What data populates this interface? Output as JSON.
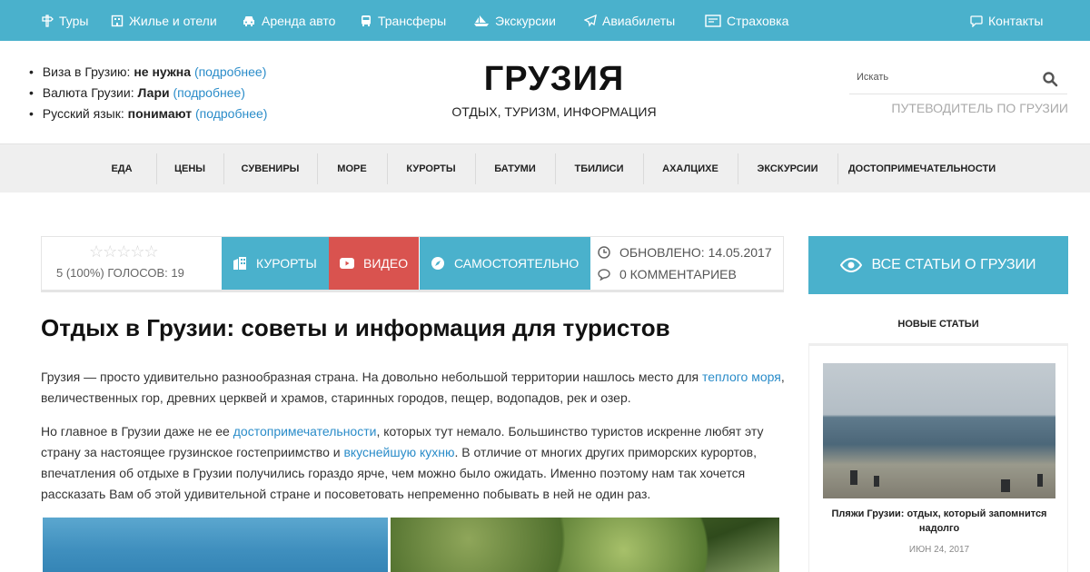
{
  "topbar": {
    "bg": "#4ab1cc",
    "items": [
      {
        "label": "Туры",
        "icon": "signpost-icon"
      },
      {
        "label": "Жилье и отели",
        "icon": "hotel-icon"
      },
      {
        "label": "Аренда авто",
        "icon": "car-icon"
      },
      {
        "label": "Трансферы",
        "icon": "bus-icon"
      },
      {
        "label": "Экскурсии",
        "icon": "ship-icon"
      },
      {
        "label": "Авиабилеты",
        "icon": "plane-icon"
      },
      {
        "label": "Страховка",
        "icon": "document-icon"
      },
      {
        "label": "Контакты",
        "icon": "chat-icon"
      }
    ]
  },
  "header": {
    "info": [
      {
        "label": "Виза в Грузию:",
        "value": "не нужна",
        "link": "(подробнее)"
      },
      {
        "label": "Валюта Грузии:",
        "value": "Лари",
        "link": "(подробнее)"
      },
      {
        "label": "Русский язык:",
        "value": "понимают",
        "link": "(подробнее)"
      }
    ],
    "title": "ГРУЗИЯ",
    "subtitle": "ОТДЫХ, ТУРИЗМ, ИНФОРМАЦИЯ",
    "search_placeholder": "Искать",
    "guide": "ПУТЕВОДИТЕЛЬ ПО ГРУЗИИ"
  },
  "nav": [
    "ЕДА",
    "ЦЕНЫ",
    "СУВЕНИРЫ",
    "МОРЕ",
    "КУРОРТЫ",
    "БАТУМИ",
    "ТБИЛИСИ",
    "АХАЛЦИХЕ",
    "ЭКСКУРСИИ",
    "ДОСТОПРИМЕЧАТЕЛЬНОСТИ"
  ],
  "meta": {
    "stars": "☆☆☆☆☆",
    "votes": "5 (100%) ГОЛОСОВ:  19",
    "buttons": [
      {
        "label": "КУРОРТЫ",
        "color": "#4ab1cc",
        "icon": "building-icon"
      },
      {
        "label": "ВИДЕО",
        "color": "#d9534f",
        "icon": "youtube-icon"
      },
      {
        "label": "САМОСТОЯТЕЛЬНО",
        "color": "#4ab1cc",
        "icon": "compass-icon"
      }
    ],
    "updated": "ОБНОВЛЕНО: 14.05.2017",
    "comments": "0 КОММЕНТАРИЕВ"
  },
  "article": {
    "title": "Отдых в Грузии: советы и информация для туристов",
    "p1": {
      "text1": "Грузия — просто удивительно разнообразная страна. На довольно небольшой территории нашлось место для ",
      "link1": "теплого моря",
      "text2": ", величественных гор, древних церквей и храмов, старинных городов, пещер, водопадов, рек и озер."
    },
    "p2": {
      "text1": "Но главное в Грузии даже не ее ",
      "link1": "достопримечательности",
      "text2": ", которых тут немало. Большинство туристов искренне любят эту страну за настоящее грузинское гостеприимство и ",
      "link2": "вкуснейшую кухню",
      "text3": ". В отличие от многих других приморских курортов, впечатления об отдыхе в Грузии получились гораздо ярче, чем можно было ожидать. Именно поэтому нам так хочется рассказать Вам об этой удивительной стране и посоветовать непременно побывать в ней не один раз."
    }
  },
  "sidebar": {
    "all_button": "ВСЕ СТАТЬИ О ГРУЗИИ",
    "new_heading": "НОВЫЕ СТАТЬИ",
    "card": {
      "title": "Пляжи Грузии: отдых, который запомнится надолго",
      "date": "ИЮН 24, 2017"
    }
  }
}
